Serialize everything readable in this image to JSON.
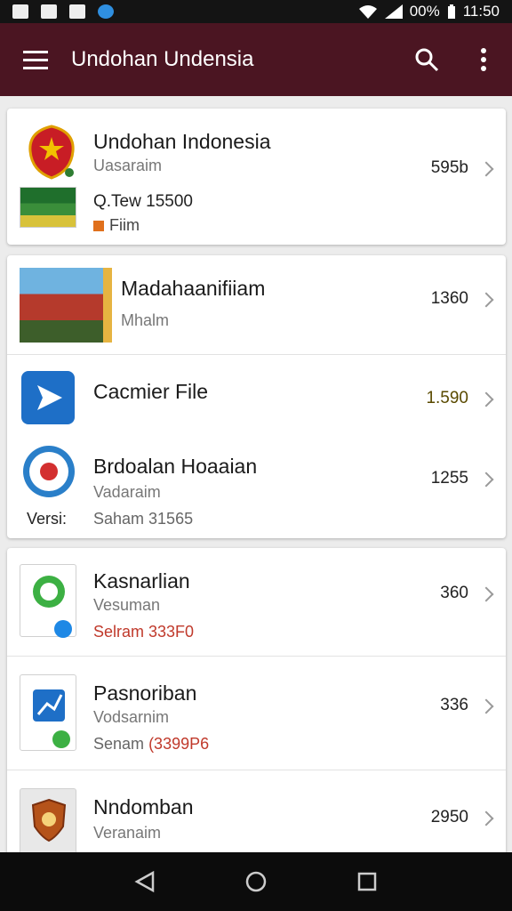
{
  "status": {
    "battery": "00%",
    "time": "11:50"
  },
  "app_bar": {
    "title": "Undohan Undensia"
  },
  "colors": {
    "toolbar": "#4b1522",
    "accent": "#e0701c",
    "red_text": "#c0392b"
  },
  "card1": {
    "title": "Undohan Indonesia",
    "subtitle": "Uasaraim",
    "info": "Q.Tew 15500",
    "tag": "Fiim",
    "value": "595b"
  },
  "card2": {
    "items": [
      {
        "title": "Madahaanifiiam",
        "subtitle": "Mhalm",
        "value": "1360"
      },
      {
        "title": "Cacmier File",
        "value": "1.590"
      },
      {
        "title": "Brdoalan Hoaaian",
        "subtitle": "Vadaraim",
        "meta_left": "Versi:",
        "meta": "Saham 31565",
        "value": "1255"
      }
    ]
  },
  "card3": {
    "items": [
      {
        "title": "Kasnarlian",
        "subtitle": "Vesuman",
        "meta": "Selram 333F0",
        "value": "360"
      },
      {
        "title": "Pasnoriban",
        "subtitle": "Vodsarnim",
        "meta_prefix": "Senam",
        "meta_red": "(3399P6",
        "value": "336"
      },
      {
        "title": "Nndomban",
        "subtitle": "Veranaim",
        "value": "2950"
      }
    ]
  }
}
